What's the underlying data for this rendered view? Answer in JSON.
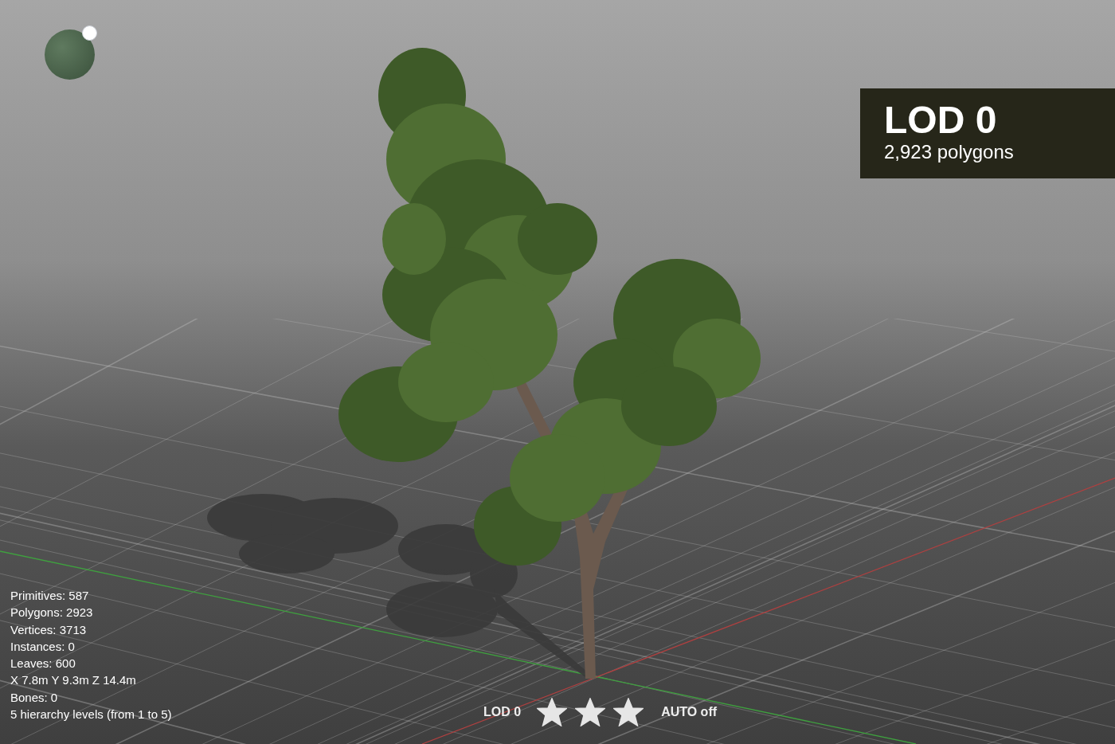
{
  "lod_panel": {
    "title": "LOD 0",
    "subtitle": "2,923 polygons"
  },
  "stats": [
    "Primitives: 587",
    "Polygons: 2923",
    "Vertices: 3713",
    "Instances: 0",
    "Leaves: 600",
    "X 7.8m Y 9.3m Z 14.4m",
    "Bones: 0",
    "5 hierarchy levels (from 1 to 5)"
  ],
  "bottom_bar": {
    "lod_label": "LOD 0",
    "auto_label": "AUTO off"
  }
}
